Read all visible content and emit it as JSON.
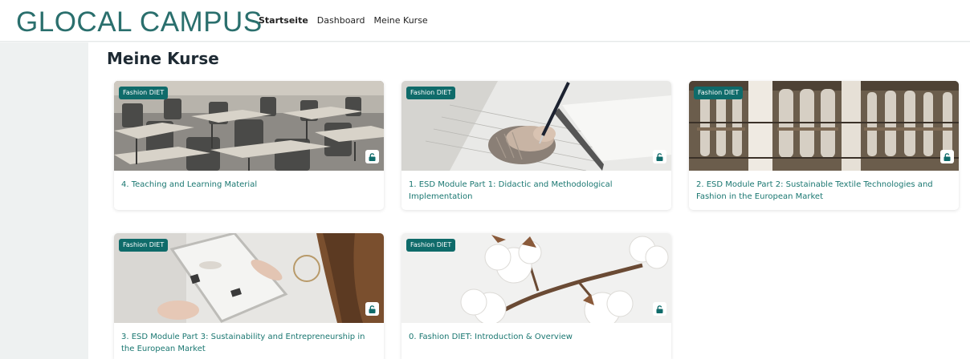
{
  "header": {
    "logo": "GLOCAL CAMPUS",
    "nav": [
      "Startseite",
      "Dashboard",
      "Meine Kurse"
    ]
  },
  "page_title": "Meine Kurse",
  "courses": [
    {
      "category": "Fashion DIET",
      "title": "4. Teaching and Learning Material",
      "image": "classroom-desks"
    },
    {
      "category": "Fashion DIET",
      "title": "1. ESD Module Part 1: Didactic and Methodological Implementation",
      "image": "hand-writing"
    },
    {
      "category": "Fashion DIET",
      "title": "2. ESD Module Part 2: Sustainable Textile Technologies and Fashion in the European Market",
      "image": "textile-spools"
    },
    {
      "category": "Fashion DIET",
      "title": "3. ESD Module Part 3: Sustainability and Entrepreneurship in the European Market",
      "image": "woman-with-tablet"
    },
    {
      "category": "Fashion DIET",
      "title": "0. Fashion DIET: Introduction & Overview",
      "image": "cotton-branch"
    }
  ],
  "colors": {
    "brand": "#2a6f6d",
    "badge": "#0f6b6a",
    "course_title": "#1a7771"
  },
  "icons": {
    "lock": "unlock-icon"
  }
}
